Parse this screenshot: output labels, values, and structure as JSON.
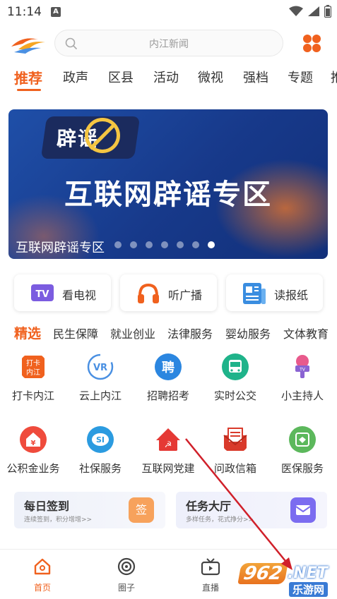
{
  "status_bar": {
    "time": "11:14",
    "notification_letter": "A"
  },
  "search": {
    "placeholder": "内江新闻"
  },
  "tabs": [
    {
      "label": "推荐",
      "active": true
    },
    {
      "label": "政声"
    },
    {
      "label": "区县"
    },
    {
      "label": "活动"
    },
    {
      "label": "微视"
    },
    {
      "label": "强档"
    },
    {
      "label": "专题"
    },
    {
      "label": "推"
    }
  ],
  "banner": {
    "badge_text": "辟谣",
    "title": "互联网辟谣专区",
    "caption": "互联网辟谣专区",
    "slide_count": 7,
    "active_slide": 7
  },
  "quick_links": [
    {
      "label": "看电视",
      "icon": "tv-icon"
    },
    {
      "label": "听广播",
      "icon": "headphones-icon"
    },
    {
      "label": "读报纸",
      "icon": "newspaper-icon"
    }
  ],
  "categories": [
    {
      "label": "精选",
      "active": true
    },
    {
      "label": "民生保障"
    },
    {
      "label": "就业创业"
    },
    {
      "label": "法律服务"
    },
    {
      "label": "婴幼服务"
    },
    {
      "label": "文体教育"
    }
  ],
  "services": [
    {
      "label": "打卡内江",
      "icon": "checkin-icon",
      "color": "#f0611e"
    },
    {
      "label": "云上内江",
      "icon": "vr-icon",
      "color": "#4a90e2"
    },
    {
      "label": "招聘招考",
      "icon": "recruit-icon",
      "color": "#2b86e0"
    },
    {
      "label": "实时公交",
      "icon": "bus-icon",
      "color": "#1fb38a"
    },
    {
      "label": "小主持人",
      "icon": "microphone-icon",
      "color": "#8a63d2"
    },
    {
      "label": "公积金业务",
      "icon": "fund-icon",
      "color": "#ef4b3c"
    },
    {
      "label": "社保服务",
      "icon": "social-security-icon",
      "color": "#2b9be0"
    },
    {
      "label": "互联网党建",
      "icon": "party-icon",
      "color": "#e53935"
    },
    {
      "label": "问政信箱",
      "icon": "mailbox-icon",
      "color": "#d93a2b"
    },
    {
      "label": "医保服务",
      "icon": "medical-icon",
      "color": "#5cb85c"
    }
  ],
  "cards": [
    {
      "title": "每日签到",
      "subtitle": "连续签到，积分增增>>",
      "icon_text": "签",
      "color": "#f7a25c"
    },
    {
      "title": "任务大厅",
      "subtitle": "多样任务，花式挣分>>",
      "icon": "task-icon",
      "color": "#7b6cf0"
    }
  ],
  "nav": [
    {
      "label": "首页",
      "icon": "home-icon",
      "active": true
    },
    {
      "label": "圈子",
      "icon": "circle-icon"
    },
    {
      "label": "直播",
      "icon": "live-icon"
    }
  ],
  "watermark": {
    "brand": "962",
    "suffix": ".NET",
    "site": "乐游网"
  },
  "colors": {
    "accent": "#f0611e",
    "banner": "#1f4fa8"
  }
}
